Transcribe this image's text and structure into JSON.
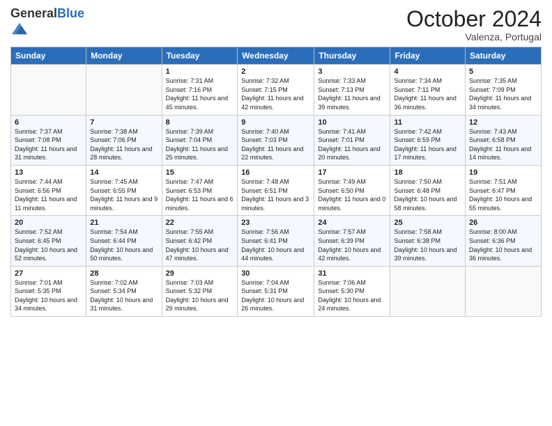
{
  "header": {
    "logo_general": "General",
    "logo_blue": "Blue",
    "month_title": "October 2024",
    "subtitle": "Valenza, Portugal"
  },
  "weekdays": [
    "Sunday",
    "Monday",
    "Tuesday",
    "Wednesday",
    "Thursday",
    "Friday",
    "Saturday"
  ],
  "weeks": [
    [
      {
        "day": "",
        "info": ""
      },
      {
        "day": "",
        "info": ""
      },
      {
        "day": "1",
        "info": "Sunrise: 7:31 AM\nSunset: 7:16 PM\nDaylight: 11 hours and 45 minutes."
      },
      {
        "day": "2",
        "info": "Sunrise: 7:32 AM\nSunset: 7:15 PM\nDaylight: 11 hours and 42 minutes."
      },
      {
        "day": "3",
        "info": "Sunrise: 7:33 AM\nSunset: 7:13 PM\nDaylight: 11 hours and 39 minutes."
      },
      {
        "day": "4",
        "info": "Sunrise: 7:34 AM\nSunset: 7:11 PM\nDaylight: 11 hours and 36 minutes."
      },
      {
        "day": "5",
        "info": "Sunrise: 7:35 AM\nSunset: 7:09 PM\nDaylight: 11 hours and 34 minutes."
      }
    ],
    [
      {
        "day": "6",
        "info": "Sunrise: 7:37 AM\nSunset: 7:08 PM\nDaylight: 11 hours and 31 minutes."
      },
      {
        "day": "7",
        "info": "Sunrise: 7:38 AM\nSunset: 7:06 PM\nDaylight: 11 hours and 28 minutes."
      },
      {
        "day": "8",
        "info": "Sunrise: 7:39 AM\nSunset: 7:04 PM\nDaylight: 11 hours and 25 minutes."
      },
      {
        "day": "9",
        "info": "Sunrise: 7:40 AM\nSunset: 7:03 PM\nDaylight: 11 hours and 22 minutes."
      },
      {
        "day": "10",
        "info": "Sunrise: 7:41 AM\nSunset: 7:01 PM\nDaylight: 11 hours and 20 minutes."
      },
      {
        "day": "11",
        "info": "Sunrise: 7:42 AM\nSunset: 6:59 PM\nDaylight: 11 hours and 17 minutes."
      },
      {
        "day": "12",
        "info": "Sunrise: 7:43 AM\nSunset: 6:58 PM\nDaylight: 11 hours and 14 minutes."
      }
    ],
    [
      {
        "day": "13",
        "info": "Sunrise: 7:44 AM\nSunset: 6:56 PM\nDaylight: 11 hours and 11 minutes."
      },
      {
        "day": "14",
        "info": "Sunrise: 7:45 AM\nSunset: 6:55 PM\nDaylight: 11 hours and 9 minutes."
      },
      {
        "day": "15",
        "info": "Sunrise: 7:47 AM\nSunset: 6:53 PM\nDaylight: 11 hours and 6 minutes."
      },
      {
        "day": "16",
        "info": "Sunrise: 7:48 AM\nSunset: 6:51 PM\nDaylight: 11 hours and 3 minutes."
      },
      {
        "day": "17",
        "info": "Sunrise: 7:49 AM\nSunset: 6:50 PM\nDaylight: 11 hours and 0 minutes."
      },
      {
        "day": "18",
        "info": "Sunrise: 7:50 AM\nSunset: 6:48 PM\nDaylight: 10 hours and 58 minutes."
      },
      {
        "day": "19",
        "info": "Sunrise: 7:51 AM\nSunset: 6:47 PM\nDaylight: 10 hours and 55 minutes."
      }
    ],
    [
      {
        "day": "20",
        "info": "Sunrise: 7:52 AM\nSunset: 6:45 PM\nDaylight: 10 hours and 52 minutes."
      },
      {
        "day": "21",
        "info": "Sunrise: 7:54 AM\nSunset: 6:44 PM\nDaylight: 10 hours and 50 minutes."
      },
      {
        "day": "22",
        "info": "Sunrise: 7:55 AM\nSunset: 6:42 PM\nDaylight: 10 hours and 47 minutes."
      },
      {
        "day": "23",
        "info": "Sunrise: 7:56 AM\nSunset: 6:41 PM\nDaylight: 10 hours and 44 minutes."
      },
      {
        "day": "24",
        "info": "Sunrise: 7:57 AM\nSunset: 6:39 PM\nDaylight: 10 hours and 42 minutes."
      },
      {
        "day": "25",
        "info": "Sunrise: 7:58 AM\nSunset: 6:38 PM\nDaylight: 10 hours and 39 minutes."
      },
      {
        "day": "26",
        "info": "Sunrise: 8:00 AM\nSunset: 6:36 PM\nDaylight: 10 hours and 36 minutes."
      }
    ],
    [
      {
        "day": "27",
        "info": "Sunrise: 7:01 AM\nSunset: 5:35 PM\nDaylight: 10 hours and 34 minutes."
      },
      {
        "day": "28",
        "info": "Sunrise: 7:02 AM\nSunset: 5:34 PM\nDaylight: 10 hours and 31 minutes."
      },
      {
        "day": "29",
        "info": "Sunrise: 7:03 AM\nSunset: 5:32 PM\nDaylight: 10 hours and 29 minutes."
      },
      {
        "day": "30",
        "info": "Sunrise: 7:04 AM\nSunset: 5:31 PM\nDaylight: 10 hours and 26 minutes."
      },
      {
        "day": "31",
        "info": "Sunrise: 7:06 AM\nSunset: 5:30 PM\nDaylight: 10 hours and 24 minutes."
      },
      {
        "day": "",
        "info": ""
      },
      {
        "day": "",
        "info": ""
      }
    ]
  ]
}
